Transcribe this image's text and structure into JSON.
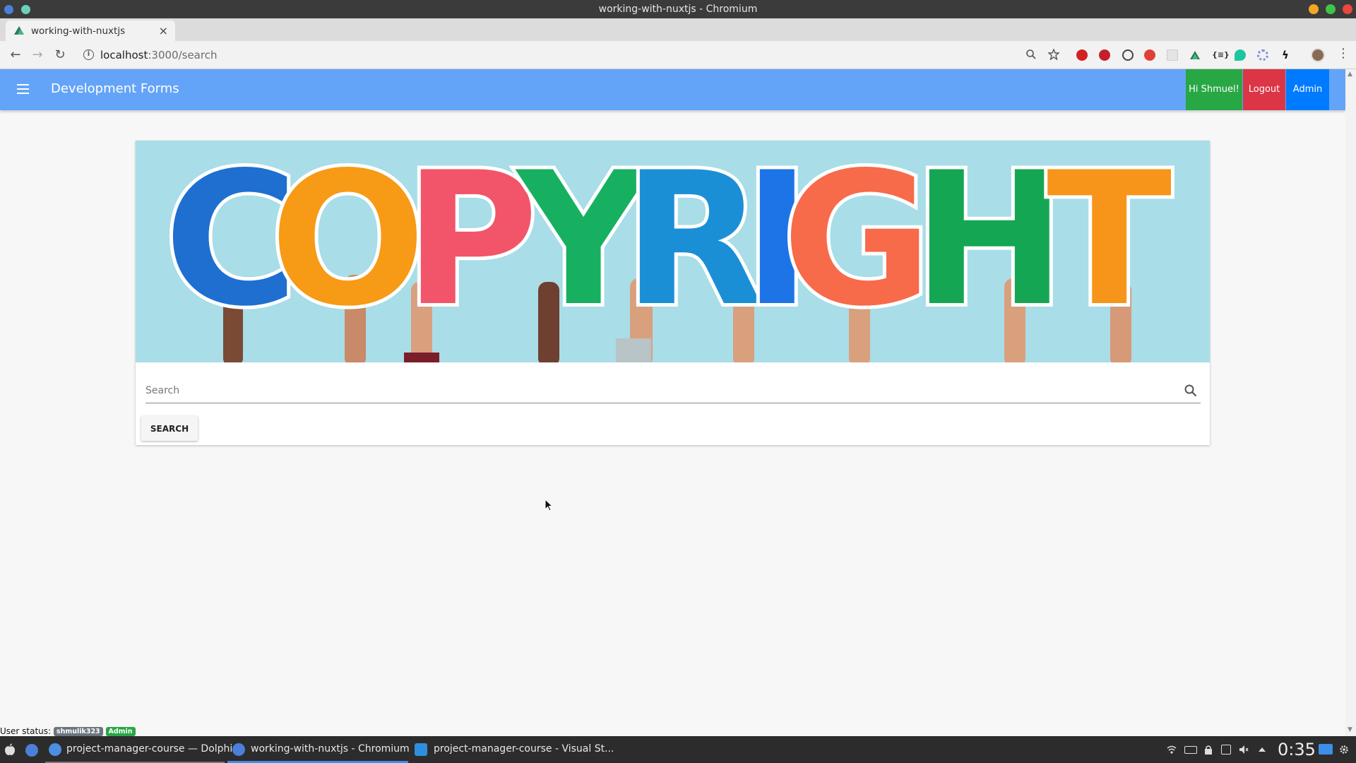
{
  "window": {
    "title": "working-with-nuxtjs - Chromium"
  },
  "browser": {
    "tab_title": "working-with-nuxtjs",
    "tab_close": "×",
    "new_tab": "+",
    "url_host": "localhost",
    "url_path": ":3000/search"
  },
  "app": {
    "title": "Development Forms",
    "greeting_button": "Hi Shmuel!",
    "logout_button": "Logout",
    "admin_button": "Admin",
    "colors": {
      "appbar": "#64a4f8",
      "greeting": "#28a745",
      "logout": "#dc3545",
      "admin": "#007bff"
    }
  },
  "banner": {
    "text": "COPYRIGHT",
    "letter_colors": [
      "#1e6fd0",
      "#f79a16",
      "#f2546a",
      "#17b060",
      "#1b8fd6",
      "#1c74e6",
      "#f76a4a",
      "#14a653",
      "#f7941a"
    ]
  },
  "search": {
    "placeholder": "Search",
    "value": "",
    "button_label": "SEARCH"
  },
  "status": {
    "label": "User status:",
    "username": "shmulik323",
    "role": "Admin"
  },
  "taskbar": {
    "items": [
      {
        "label": "project-manager-course — Dolphin"
      },
      {
        "label": "working-with-nuxtjs - Chromium"
      },
      {
        "label": "project-manager-course - Visual St..."
      }
    ],
    "clock": "0:35"
  }
}
